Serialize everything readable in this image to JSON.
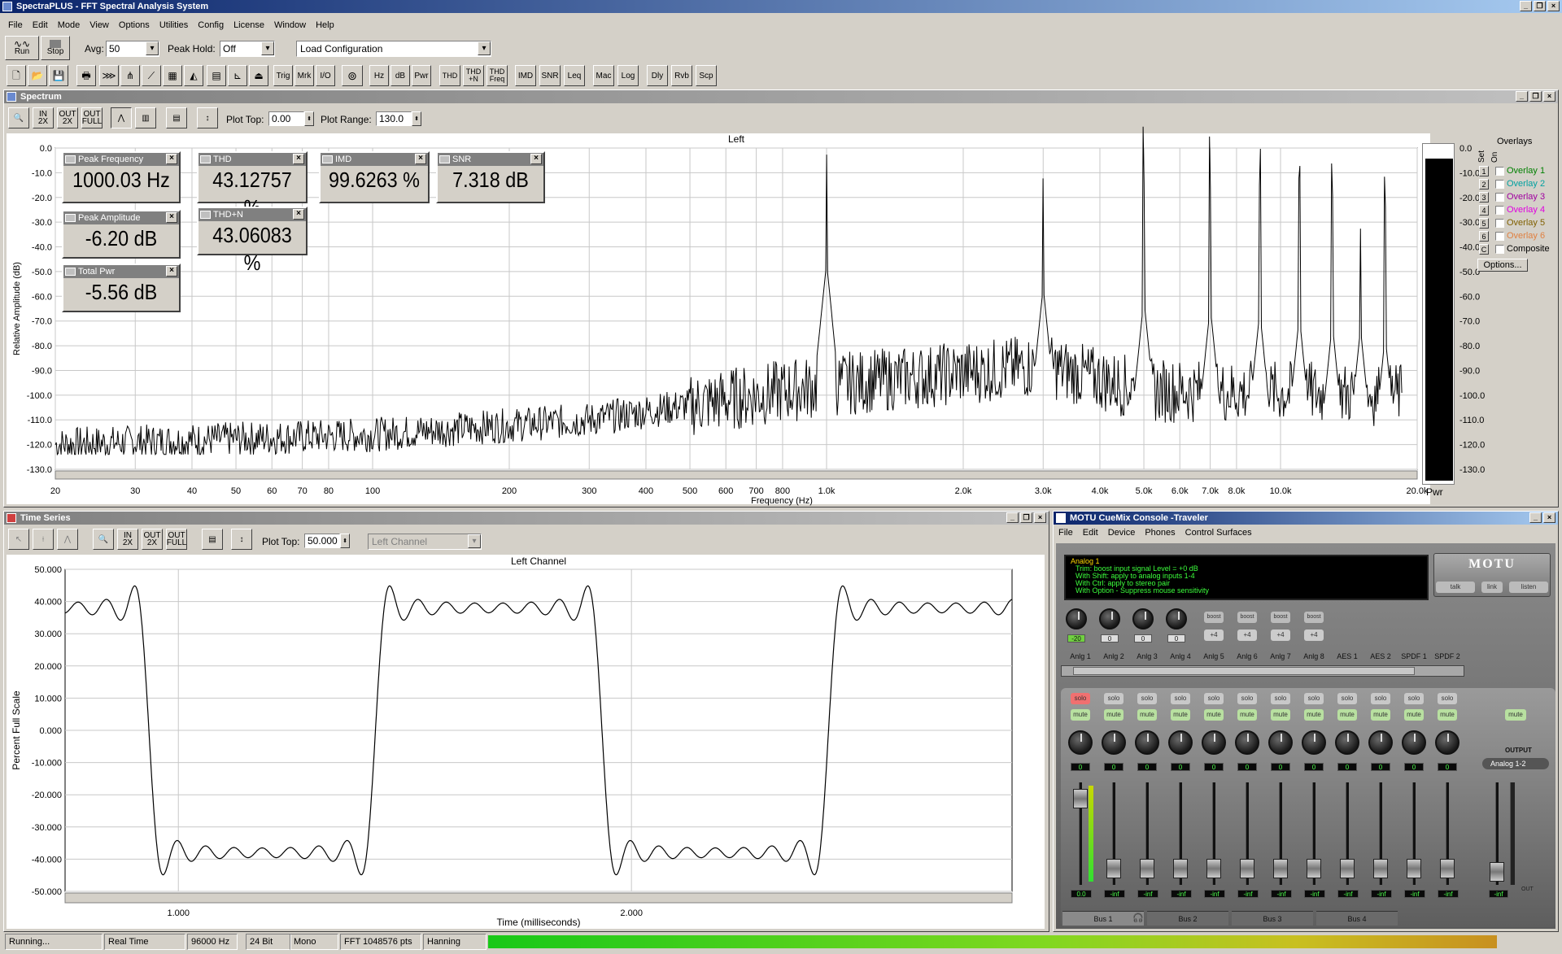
{
  "app": {
    "title": "SpectraPLUS - FFT Spectral Analysis System"
  },
  "menu": [
    "File",
    "Edit",
    "Mode",
    "View",
    "Options",
    "Utilities",
    "Config",
    "License",
    "Window",
    "Help"
  ],
  "toolbar1": {
    "run_label": "Run",
    "stop_label": "Stop",
    "avg_label": "Avg:",
    "avg_value": "50",
    "peak_hold_label": "Peak Hold:",
    "peak_hold_value": "Off",
    "config_value": "Load Configuration"
  },
  "toolbar2": [
    "Trig",
    "Mrk",
    "I/O",
    "Hz",
    "dB",
    "Pwr",
    "THD",
    "THD +N",
    "THD Freq",
    "IMD",
    "SNR",
    "Leq",
    "Mac",
    "Log",
    "Dly",
    "Rvb",
    "Scp"
  ],
  "spectrum": {
    "title": "Spectrum",
    "plot_top_label": "Plot Top:",
    "plot_top_value": "0.00",
    "plot_range_label": "Plot Range:",
    "plot_range_value": "130.0",
    "meters": [
      {
        "name": "Peak Frequency",
        "value": "1000.03 Hz"
      },
      {
        "name": "THD",
        "value": "43.12757 %"
      },
      {
        "name": "IMD",
        "value": "99.6263 %"
      },
      {
        "name": "SNR",
        "value": "7.318 dB"
      },
      {
        "name": "Peak Amplitude",
        "value": "-6.20 dB"
      },
      {
        "name": "THD+N",
        "value": "43.06083 %"
      },
      {
        "name": "Total Pwr",
        "value": "-5.56 dB"
      }
    ],
    "overlays": {
      "title": "Overlays",
      "set_label": "Set",
      "on_label": "On",
      "items": [
        {
          "num": "1",
          "label": "Overlay 1",
          "color": "#008000"
        },
        {
          "num": "2",
          "label": "Overlay 2",
          "color": "#00a0a0"
        },
        {
          "num": "3",
          "label": "Overlay 3",
          "color": "#a000a0"
        },
        {
          "num": "4",
          "label": "Overlay 4",
          "color": "#e000e0"
        },
        {
          "num": "5",
          "label": "Overlay 5",
          "color": "#806000"
        },
        {
          "num": "6",
          "label": "Overlay 6",
          "color": "#e08040"
        },
        {
          "num": "C",
          "label": "Composite",
          "color": "#000000"
        }
      ],
      "options_label": "Options..."
    },
    "pwr_label": "Pwr"
  },
  "chart_data": [
    {
      "type": "line",
      "title": "Left",
      "xlabel": "Frequency (Hz)",
      "ylabel": "Relative Amplitude (dB)",
      "x_scale": "log",
      "xlim": [
        20,
        20000
      ],
      "ylim": [
        -130,
        0
      ],
      "yticks": [
        "0.0",
        "-10.0",
        "-20.0",
        "-30.0",
        "-40.0",
        "-50.0",
        "-60.0",
        "-70.0",
        "-80.0",
        "-90.0",
        "-100.0",
        "-110.0",
        "-120.0",
        "-130.0"
      ],
      "xticks": [
        "20",
        "30",
        "40",
        "50",
        "60",
        "70",
        "80",
        "100",
        "200",
        "300",
        "400",
        "500",
        "600",
        "700",
        "800",
        "1.0k",
        "2.0k",
        "3.0k",
        "4.0k",
        "5.0k",
        "6.0k",
        "7.0k",
        "8.0k",
        "10.0k",
        "20.0k"
      ],
      "xtick_values": [
        20,
        30,
        40,
        50,
        60,
        70,
        80,
        100,
        200,
        300,
        400,
        500,
        600,
        700,
        800,
        1000,
        2000,
        3000,
        4000,
        5000,
        6000,
        7000,
        8000,
        10000,
        20000
      ],
      "peaks": [
        [
          1000,
          -6.2
        ],
        [
          3000,
          -16
        ],
        [
          5000,
          -21
        ],
        [
          7000,
          -24
        ],
        [
          9000,
          -26
        ],
        [
          11000,
          -28
        ],
        [
          13000,
          -31
        ],
        [
          15000,
          -33
        ],
        [
          17000,
          -36
        ],
        [
          19000,
          -38
        ]
      ],
      "noise_floor": [
        [
          20,
          -120
        ],
        [
          100,
          -116
        ],
        [
          300,
          -110
        ],
        [
          700,
          -100
        ],
        [
          1000,
          -96
        ],
        [
          3000,
          -88
        ],
        [
          5000,
          -98
        ],
        [
          20000,
          -100
        ]
      ],
      "grid": true
    },
    {
      "type": "line",
      "title": "Left Channel",
      "xlabel": "Time (milliseconds)",
      "ylabel": "Percent Full Scale",
      "ylim": [
        -50,
        50
      ],
      "xlim": [
        0.75,
        2.84
      ],
      "yticks": [
        "50.000",
        "40.000",
        "30.000",
        "20.000",
        "10.000",
        "0.000",
        "-10.000",
        "-20.000",
        "-30.000",
        "-40.000",
        "-50.000"
      ],
      "xticks": [
        "1.000",
        "2.000"
      ],
      "xtick_values": [
        1.0,
        2.0
      ],
      "series": [
        {
          "values_desc": "square wave ±38 with Gibbs ringing",
          "amplitude": 38,
          "overshoot": 44,
          "period_ms": 1.0,
          "edges_ms": [
            0.935,
            1.465,
            1.935,
            2.465
          ]
        }
      ],
      "grid": true
    }
  ],
  "timeseries": {
    "title": "Time Series",
    "plot_top_label": "Plot Top:",
    "plot_top_value": "50.000",
    "channel_value": "Left Channel"
  },
  "motu": {
    "title": "MOTU CueMix Console -Traveler",
    "menu": [
      "File",
      "Edit",
      "Device",
      "Phones",
      "Control Surfaces"
    ],
    "lcd_title": "Analog 1",
    "lcd_lines": [
      "Trim: boost input signal Level = +0 dB",
      "With Shift: apply to analog inputs 1-4",
      "With Ctrl: apply to stereo pair",
      "With Option - Suppress mouse sensitivity"
    ],
    "logo": "MOTU",
    "talk": "talk",
    "link": "link",
    "listen": "listen",
    "trim_values": [
      "-20",
      "0",
      "0",
      "0"
    ],
    "boost_label": "boost",
    "boost_val": "+4",
    "channels": [
      "Anlg 1",
      "Anlg 2",
      "Anlg 3",
      "Anlg 4",
      "Anlg 5",
      "Anlg 6",
      "Anlg 7",
      "Anlg 8",
      "AES 1",
      "AES 2",
      "SPDF 1",
      "SPDF 2"
    ],
    "solo": "solo",
    "mute": "mute",
    "pan_value": "0",
    "fader_values": [
      "0.0",
      "-inf",
      "-inf",
      "-inf",
      "-inf",
      "-inf",
      "-inf",
      "-inf",
      "-inf",
      "-inf",
      "-inf",
      "-inf"
    ],
    "output_label": "OUTPUT",
    "output_value": "Analog 1-2",
    "out_label": "OUT",
    "out_fader_value": "-inf",
    "buses": [
      "Bus 1",
      "Bus 2",
      "Bus 3",
      "Bus 4"
    ]
  },
  "status": {
    "state": "Running...",
    "mode": "Real Time",
    "rate": "96000 Hz",
    "bits": "24 Bit",
    "channels": "Mono",
    "fft": "FFT 1048576 pts",
    "window": "Hanning"
  }
}
